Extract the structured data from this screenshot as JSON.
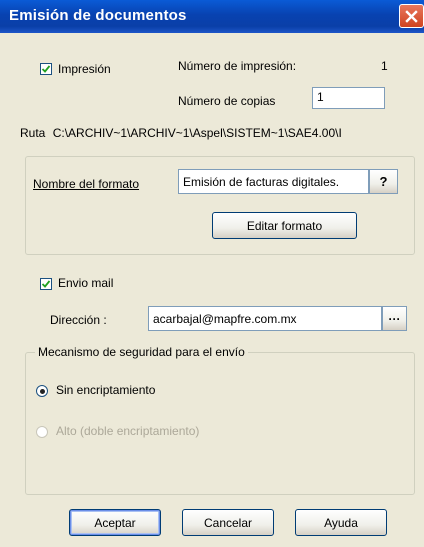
{
  "window": {
    "title": "Emisión de documentos"
  },
  "impresion": {
    "checkbox_label": "Impresión",
    "checked": true,
    "numero_impresion_label": "Número de impresión:",
    "numero_impresion_value": "1",
    "numero_copias_label": "Número de copias",
    "numero_copias_value": "1"
  },
  "ruta": {
    "label": "Ruta",
    "value": "C:\\ARCHIV~1\\ARCHIV~1\\Aspel\\SISTEM~1\\SAE4.00\\I"
  },
  "formato": {
    "label": "Nombre del formato",
    "value": "Emisión de facturas digitales.",
    "help_label": "?",
    "editar_label": "Editar formato"
  },
  "mail": {
    "checkbox_label": "Envio mail",
    "checked": true,
    "direccion_label": "Dirección :",
    "direccion_value": "acarbajal@mapfre.com.mx",
    "browse_label": "···"
  },
  "seguridad": {
    "group_label": "Mecanismo de seguridad para el envío",
    "option1_label": "Sin encriptamiento",
    "option2_label": "Alto (doble encriptamiento)",
    "selected": "option1"
  },
  "buttons": {
    "aceptar": "Aceptar",
    "cancelar": "Cancelar",
    "ayuda": "Ayuda"
  },
  "colors": {
    "titlebar": "#0a4fc8",
    "close": "#d9542f",
    "dialog_bg": "#ece9d8"
  }
}
